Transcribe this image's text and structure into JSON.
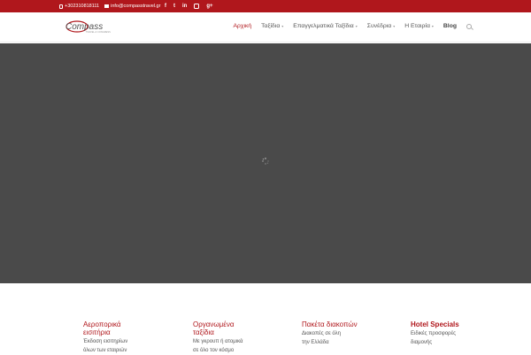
{
  "topbar": {
    "phone": "+302310818111",
    "email": "info@compasstravel.gr",
    "social_icons": [
      "facebook-icon",
      "twitter-icon",
      "linkedin-icon",
      "instagram-icon",
      "google-plus-icon"
    ]
  },
  "brand": {
    "logo_text": "Compass",
    "logo_tagline": "TRAVEL & CONGRESS",
    "accent": "#b0171c"
  },
  "nav": {
    "items": [
      {
        "label": "Αρχική",
        "active": true,
        "dropdown": false
      },
      {
        "label": "Ταξίδια",
        "active": false,
        "dropdown": true
      },
      {
        "label": "Επαγγελματικά Ταξίδια",
        "active": false,
        "dropdown": true
      },
      {
        "label": "Συνέδρια",
        "active": false,
        "dropdown": true
      },
      {
        "label": "Η Εταιρία",
        "active": false,
        "dropdown": true
      },
      {
        "label": "Blog",
        "active": false,
        "dropdown": false
      }
    ],
    "search_icon": "search-icon"
  },
  "hero": {
    "background": "#4a4a4a",
    "loader_icon": "loading-spinner-icon"
  },
  "features": [
    {
      "title_lines": [
        "Αεροπορικά",
        "εισιτήρια"
      ],
      "text_lines": [
        "Έκδοση εισιτηρίων",
        "όλων των εταιριών"
      ]
    },
    {
      "title_lines": [
        "Οργανωμένα",
        "ταξίδια"
      ],
      "text_lines": [
        "Με γκρουπ ή ατομικά",
        "σε όλο τον κόσμο"
      ]
    },
    {
      "title_lines": [
        "Πακέτα διακοπών"
      ],
      "text_lines": [
        "Διακοπές σε όλη",
        "την Ελλάδα"
      ]
    },
    {
      "title_lines": [
        "Hotel Specials"
      ],
      "text_lines": [
        "Ειδικές προσφορές",
        "διαμονής"
      ]
    }
  ]
}
